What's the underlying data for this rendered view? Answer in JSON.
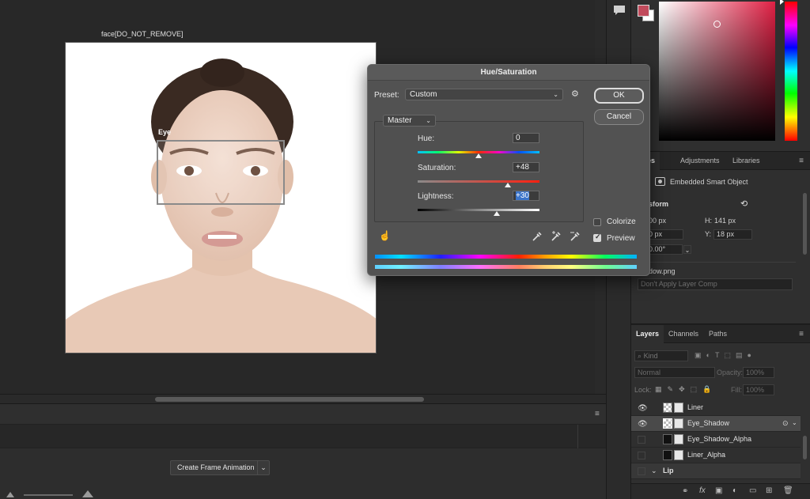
{
  "canvas": {
    "layer_label": "face[DO_NOT_REMOVE]",
    "selection_label": "Eye"
  },
  "timeline": {
    "create_button": "Create Frame Animation"
  },
  "color_panel": {
    "foreground_color": "#c14b5c",
    "background_color": "#ffffff"
  },
  "properties": {
    "tabs": [
      "erties",
      "Adjustments",
      "Libraries"
    ],
    "type_label": "Embedded Smart Object",
    "transform_label": "sform",
    "w_value": "00 px",
    "h_label": "H:",
    "h_value": "141 px",
    "x_value": "0 px",
    "y_label": "Y:",
    "y_value": "18 px",
    "angle_value": "0.00°",
    "file_name": "dow.png",
    "layer_comp": "Don't Apply Layer Comp"
  },
  "layers": {
    "tabs": [
      "Layers",
      "Channels",
      "Paths"
    ],
    "filter_kind": "Kind",
    "blend_mode": "Normal",
    "opacity_label": "Opacity:",
    "opacity_value": "100%",
    "lock_label": "Lock:",
    "fill_label": "Fill:",
    "fill_value": "100%",
    "rows": [
      {
        "name": "Liner"
      },
      {
        "name": "Eye_Shadow"
      },
      {
        "name": "Eye_Shadow_Alpha"
      },
      {
        "name": "Liner_Alpha"
      },
      {
        "name": "Lip"
      }
    ]
  },
  "dialog": {
    "title": "Hue/Saturation",
    "preset_label": "Preset:",
    "preset_value": "Custom",
    "ok": "OK",
    "cancel": "Cancel",
    "channel": "Master",
    "hue_label": "Hue:",
    "hue_value": "0",
    "hue_level": 0,
    "saturation_label": "Saturation:",
    "saturation_value": "+48",
    "saturation_level": 48,
    "lightness_label": "Lightness:",
    "lightness_value": "+30",
    "lightness_level": 30,
    "colorize_label": "Colorize",
    "colorize_checked": false,
    "preview_label": "Preview",
    "preview_checked": true
  }
}
